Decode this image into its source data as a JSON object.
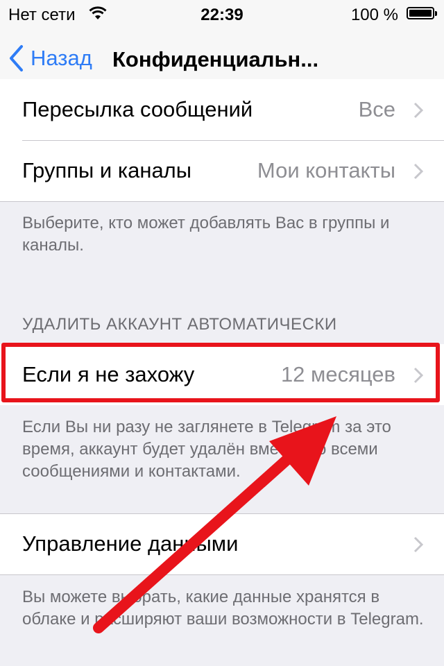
{
  "status_bar": {
    "carrier": "Нет сети",
    "time": "22:39",
    "battery": "100 %"
  },
  "nav": {
    "back_label": "Назад",
    "title": "Конфиденциальн..."
  },
  "privacy_rows": [
    {
      "label": "Пересылка сообщений",
      "value": "Все"
    },
    {
      "label": "Группы и каналы",
      "value": "Мои контакты"
    }
  ],
  "groups_footer": "Выберите, кто может добавлять Вас в группы и каналы.",
  "delete_section": {
    "header": "УДАЛИТЬ АККАУНТ АВТОМАТИЧЕСКИ",
    "row": {
      "label": "Если я не захожу",
      "value": "12 месяцев"
    },
    "footer": "Если Вы ни разу не заглянете в Telegram за это время, аккаунт будет удалён вместе со всеми сообщениями и контактами."
  },
  "data_section": {
    "row_label": "Управление данными",
    "footer": "Вы можете выбрать, какие данные хранятся в облаке и расширяют ваши возможности в Telegram."
  },
  "colors": {
    "accent": "#2e7cf6",
    "annotation": "#e8141b",
    "background": "#efeff4"
  },
  "icons": [
    "wifi-icon",
    "battery-icon",
    "back-chevron-icon",
    "disclosure-chevron-icon",
    "annotation-arrow"
  ]
}
